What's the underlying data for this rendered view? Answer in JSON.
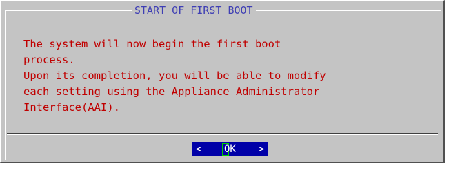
{
  "dialog": {
    "title": "START OF FIRST BOOT",
    "message": "The system will now begin the first boot\nprocess.\nUpon its completion, you will be able to modify\neach setting using the Appliance Administrator\nInterface(AAI).",
    "ok_button": {
      "left_bracket": "<",
      "label": "OK",
      "right_bracket": ">"
    }
  },
  "colors": {
    "background": "#c4c4c4",
    "title_text": "#3f3fb4",
    "message_text": "#c00000",
    "button_bg": "#0000a8",
    "button_text": "#ffffff",
    "cursor": "#00d000"
  }
}
